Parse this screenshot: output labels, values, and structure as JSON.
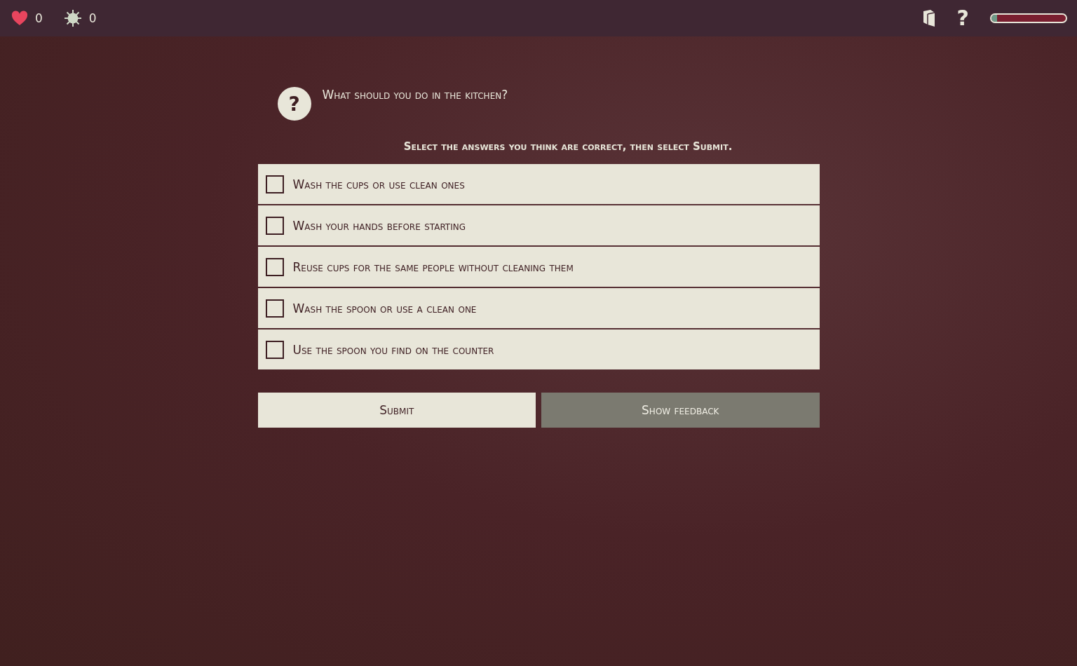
{
  "top_bar": {
    "lives": "0",
    "virus_count": "0",
    "progress": {
      "level": 0.08
    }
  },
  "question": {
    "icon": "?",
    "text": "What should you do in the kitchen?",
    "instruction": "Select the answers you think are correct, then select Submit."
  },
  "options": [
    {
      "label": "Wash the cups or use clean ones",
      "checked": false
    },
    {
      "label": "Wash your hands before starting",
      "checked": false
    },
    {
      "label": "Reuse cups for the same people without cleaning them",
      "checked": false
    },
    {
      "label": "Wash the spoon or use a clean one",
      "checked": false
    },
    {
      "label": "Use the spoon you find on the counter",
      "checked": false
    }
  ],
  "buttons": [
    {
      "label": "Submit",
      "kind": "primary"
    },
    {
      "label": "Show feedback",
      "kind": "secondary"
    }
  ]
}
